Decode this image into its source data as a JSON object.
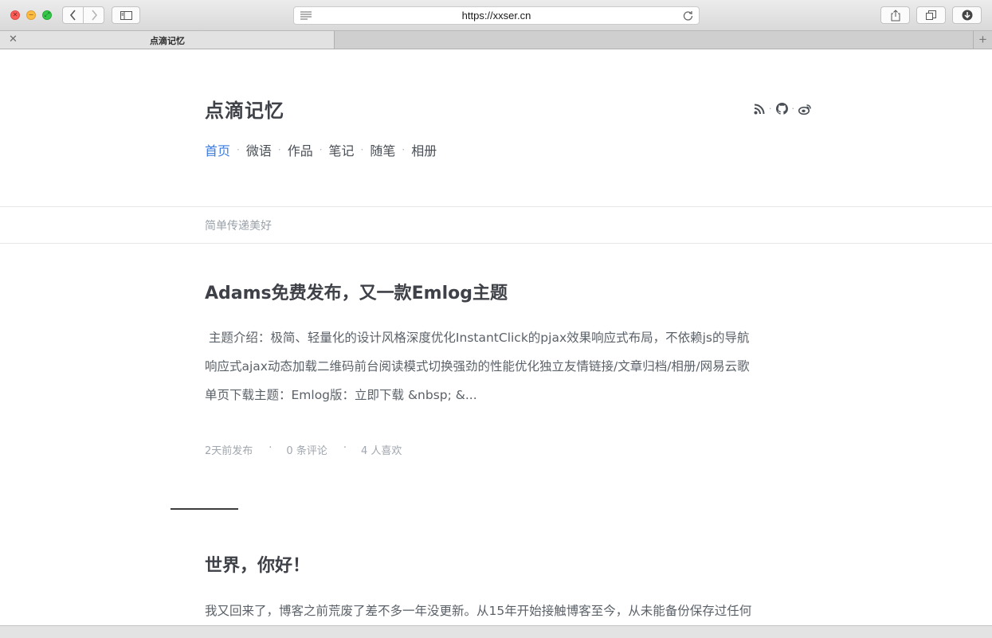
{
  "browser": {
    "url": "https://xxser.cn",
    "tab_title": "点滴记忆",
    "new_tab": "+",
    "close_tab": "✕"
  },
  "site": {
    "title": "点滴记忆",
    "tagline": "简单传递美好",
    "social": [
      "rss-icon",
      "github-icon",
      "weibo-icon"
    ],
    "accent_color": "#3b7be0"
  },
  "nav": {
    "items": [
      "首页",
      "微语",
      "作品",
      "笔记",
      "随笔",
      "相册"
    ],
    "active": "首页"
  },
  "posts": [
    {
      "title": "Adams免费发布，又一款Emlog主题",
      "excerpt_lines": [
        " 主题介绍：极简、轻量化的设计风格深度优化InstantClick的pjax效果响应式布局，不依赖js的导航",
        "响应式ajax动态加载二维码前台阅读模式切换强劲的性能优化独立友情链接/文章归档/相册/网易云歌",
        "单页下载主题：Emlog版：立即下载 &nbsp; &..."
      ],
      "meta": {
        "published": "2天前发布",
        "comments": "0 条评论",
        "likes": "4 人喜欢"
      }
    },
    {
      "title": "世界，你好！",
      "excerpt_lines": [
        "我又回来了，博客之前荒废了差不多一年没更新。从15年开始接触博客至今，从未能备份保存过任何"
      ]
    }
  ]
}
